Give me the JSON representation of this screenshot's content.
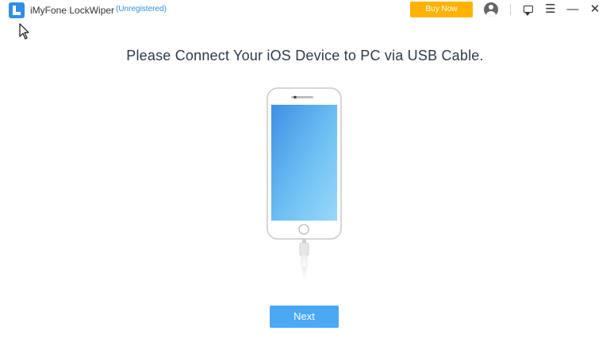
{
  "app": {
    "name": "iMyFone LockWiper",
    "status": "(Unregistered)",
    "logo_icon": "lockwiper-logo-icon",
    "brand_color": "#2f8fe6"
  },
  "toolbar": {
    "buy_now_label": "Buy Now",
    "buy_now_color": "#ffb300",
    "icons": [
      "account-icon",
      "feedback-icon",
      "menu-icon",
      "minimize-icon",
      "close-icon"
    ]
  },
  "main": {
    "instruction": "Please Connect Your iOS Device to PC via USB Cable.",
    "illustration": "iphone-with-lightning-cable",
    "next_label": "Next",
    "next_color": "#4aa8f5"
  }
}
